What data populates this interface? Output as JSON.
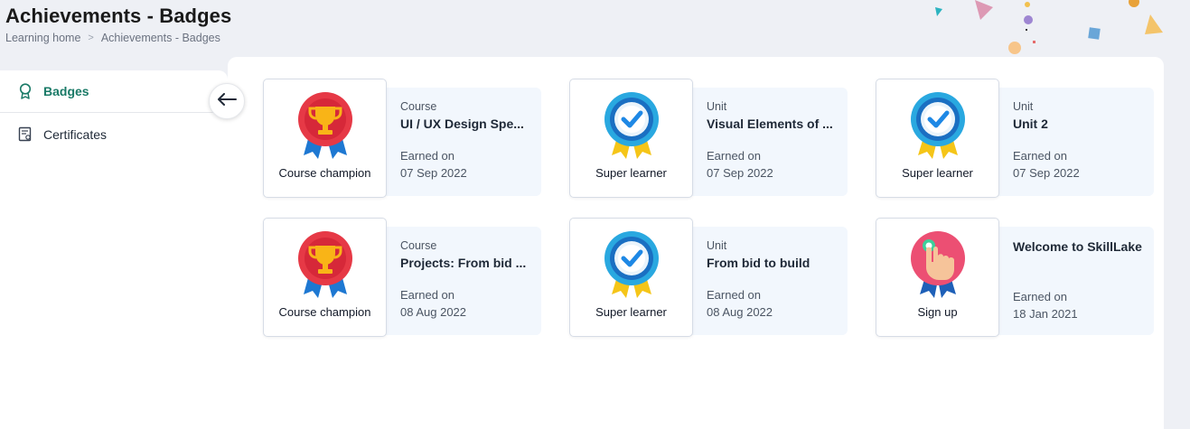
{
  "header": {
    "title": "Achievements - Badges",
    "breadcrumb": [
      {
        "label": "Learning home"
      },
      {
        "label": "Achievements - Badges"
      }
    ],
    "separator": ">"
  },
  "sidebar": {
    "items": [
      {
        "label": "Badges",
        "icon": "award-icon",
        "active": true
      },
      {
        "label": "Certificates",
        "icon": "certificate-icon",
        "active": false
      }
    ]
  },
  "colors": {
    "accent": "#1a7a67",
    "info_bg": "#f2f7fd",
    "page_bg": "#eef0f5"
  },
  "badges": [
    {
      "badge_name": "Course champion",
      "medal": "trophy-medal-icon",
      "type": "Course",
      "name": "UI / UX Design Spe...",
      "earned_label": "Earned on",
      "date": "07 Sep 2022"
    },
    {
      "badge_name": "Super learner",
      "medal": "check-medal-icon",
      "type": "Unit",
      "name": "Visual Elements of ...",
      "earned_label": "Earned on",
      "date": "07 Sep 2022"
    },
    {
      "badge_name": "Super learner",
      "medal": "check-medal-icon",
      "type": "Unit",
      "name": "Unit 2",
      "earned_label": "Earned on",
      "date": "07 Sep 2022"
    },
    {
      "badge_name": "Course champion",
      "medal": "trophy-medal-icon",
      "type": "Course",
      "name": "Projects: From bid ...",
      "earned_label": "Earned on",
      "date": "08 Aug 2022"
    },
    {
      "badge_name": "Super learner",
      "medal": "check-medal-icon",
      "type": "Unit",
      "name": "From bid to build",
      "earned_label": "Earned on",
      "date": "08 Aug 2022"
    },
    {
      "badge_name": "Sign up",
      "medal": "hand-tap-medal-icon",
      "type": "",
      "name": "Welcome to SkillLake",
      "earned_label": "Earned on",
      "date": "18 Jan 2021"
    }
  ]
}
